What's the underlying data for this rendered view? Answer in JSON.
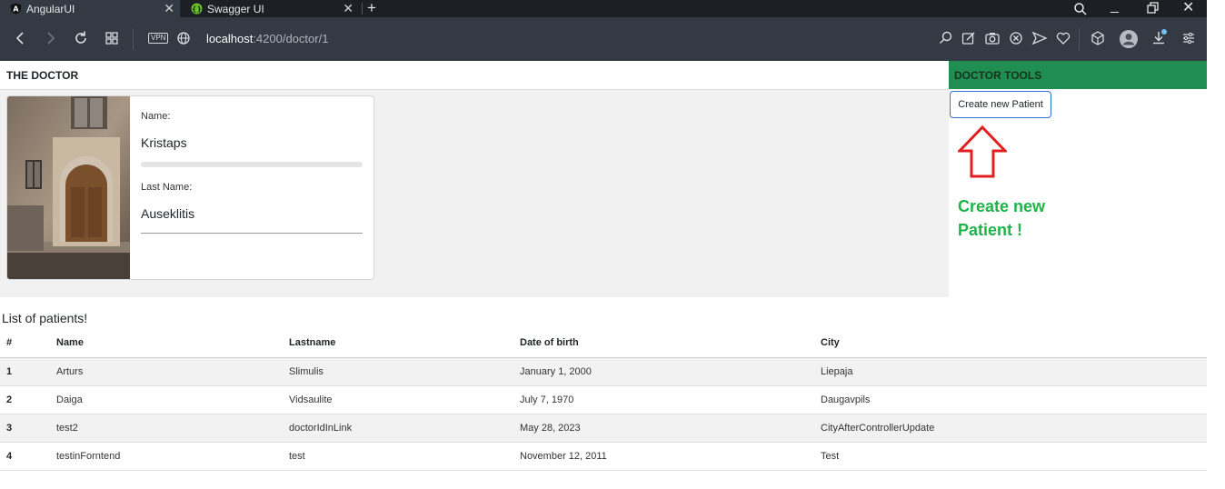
{
  "browser": {
    "tabs": [
      {
        "title": "AngularUI",
        "icon": "angular-icon",
        "active": true
      },
      {
        "title": "Swagger UI",
        "icon": "swagger-icon",
        "active": false
      }
    ],
    "address": {
      "host": "localhost",
      "path": ":4200/doctor/1"
    },
    "vpn_label": "VPN"
  },
  "doctor": {
    "section_title": "THE DOCTOR",
    "name_label": "Name:",
    "name": "Kristaps",
    "lastname_label": "Last Name:",
    "lastname": "Auseklitis",
    "progress": 0
  },
  "tools": {
    "title": "DOCTOR TOOLS",
    "create_button": "Create new Patient",
    "annotation": "Create new Patient !",
    "annotation_color": "#1fb34a",
    "arrow_color": "#e02020"
  },
  "patients": {
    "title": "List of patients!",
    "columns": [
      "#",
      "Name",
      "Lastname",
      "Date of birth",
      "City"
    ],
    "rows": [
      {
        "id": "1",
        "name": "Arturs",
        "lastname": "Slimulis",
        "dob": "January 1, 2000",
        "city": "Liepaja"
      },
      {
        "id": "2",
        "name": "Daiga",
        "lastname": "Vidsaulite",
        "dob": "July 7, 1970",
        "city": "Daugavpils"
      },
      {
        "id": "3",
        "name": "test2",
        "lastname": "doctorIdInLink",
        "dob": "May 28, 2023",
        "city": "CityAfterControllerUpdate"
      },
      {
        "id": "4",
        "name": "testinForntend",
        "lastname": "test",
        "dob": "November 12, 2011",
        "city": "Test"
      }
    ]
  },
  "colors": {
    "tools_header": "#218e51",
    "browser_toolbar": "#333a43",
    "tabbar": "#1c1f24"
  }
}
